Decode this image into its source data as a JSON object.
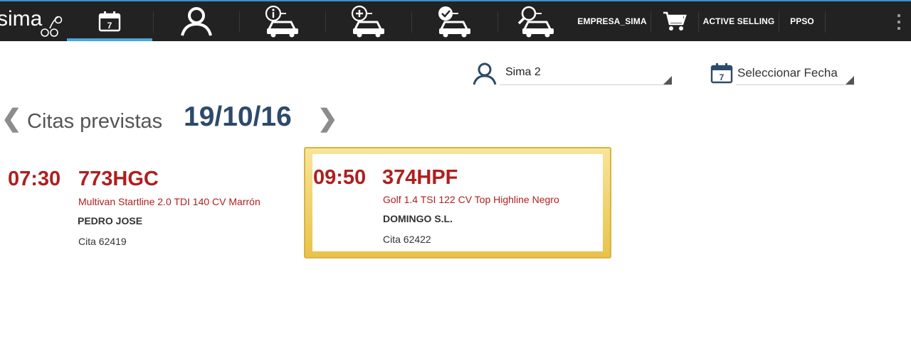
{
  "app": {
    "logo_text": "sima"
  },
  "topbar": {
    "nav_icons": [
      {
        "name": "calendar-icon",
        "day": "7",
        "active": true
      },
      {
        "name": "user-icon",
        "active": false
      },
      {
        "name": "car-info-icon",
        "active": false
      },
      {
        "name": "car-add-icon",
        "active": false
      },
      {
        "name": "car-check-icon",
        "active": false
      },
      {
        "name": "car-search-icon",
        "active": false
      }
    ],
    "empresa_label": "EMPRESA_SIMA",
    "cart_icon": "cart-icon",
    "active_selling_label": "ACTIVE SELLING",
    "ppso_label": "PPSO",
    "menu_icon": "more-vertical-icon"
  },
  "filters": {
    "advisor": {
      "icon": "user-icon",
      "value": "Sima 2"
    },
    "date": {
      "icon": "calendar-icon",
      "day": "7",
      "placeholder": "Seleccionar Fecha"
    }
  },
  "heading": {
    "prev_label": "❮",
    "title": "Citas previstas",
    "date": "19/10/16",
    "next_label": "❯"
  },
  "appointments": [
    {
      "time": "07:30",
      "plate": "773HGC",
      "model": "Multivan Startline 2.0 TDI 140 CV Marrón",
      "client": "PEDRO JOSE",
      "cita": "Cita 62419",
      "selected": false
    },
    {
      "time": "09:50",
      "plate": "374HPF",
      "model": "Golf 1.4 TSI 122 CV Top Highline Negro",
      "client": "DOMINGO S.L.",
      "cita": "Cita 62422",
      "selected": true
    }
  ],
  "colors": {
    "topbar_bg": "#222222",
    "active_tab": "#4aa6df",
    "accent_red": "#b01e1e",
    "date_blue": "#2d4a6b",
    "selected_gold": "#e8c24a"
  }
}
